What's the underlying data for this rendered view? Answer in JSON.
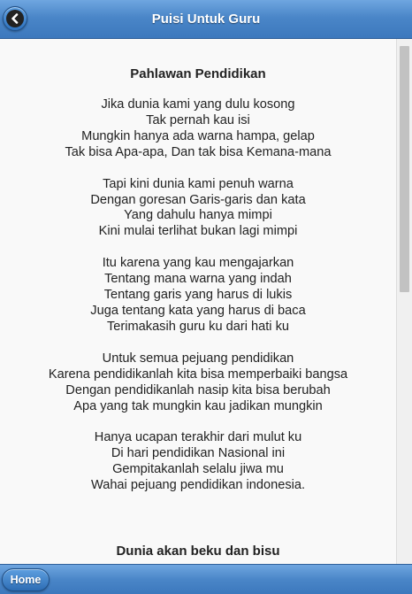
{
  "header": {
    "title": "Puisi Untuk Guru",
    "back_icon": "chevron-left-icon"
  },
  "poems": [
    {
      "title": "Pahlawan Pendidikan",
      "stanzas": [
        [
          "Jika dunia kami yang dulu kosong",
          "Tak pernah kau isi",
          "Mungkin hanya ada warna hampa, gelap",
          "Tak bisa Apa-apa, Dan tak bisa Kemana-mana"
        ],
        [
          "Tapi kini dunia kami penuh warna",
          "Dengan goresan Garis-garis dan kata",
          "Yang dahulu hanya mimpi",
          "Kini mulai terlihat bukan lagi mimpi"
        ],
        [
          "Itu karena yang kau mengajarkan",
          "Tentang mana warna yang indah",
          "Tentang garis yang harus di lukis",
          "Juga tentang kata yang harus di baca",
          "Terimakasih guru ku dari hati ku"
        ],
        [
          "Untuk semua pejuang pendidikan",
          "Karena pendidikanlah kita bisa memperbaiki bangsa",
          "Dengan pendidikanlah nasip kita bisa berubah",
          "Apa yang tak mungkin kau jadikan mungkin"
        ],
        [
          "Hanya ucapan terakhir dari mulut ku",
          "Di hari pendidikan Nasional ini",
          "Gempitakanlah selalu jiwa mu",
          "Wahai pejuang pendidikan indonesia."
        ]
      ]
    },
    {
      "title": "Dunia akan beku dan bisu",
      "stanzas": []
    }
  ],
  "footer": {
    "home_label": "Home"
  },
  "colors": {
    "bar_top": "#6fa6e0",
    "bar_bottom": "#3c78bd",
    "text": "#222222",
    "background": "#f9f9f9"
  }
}
